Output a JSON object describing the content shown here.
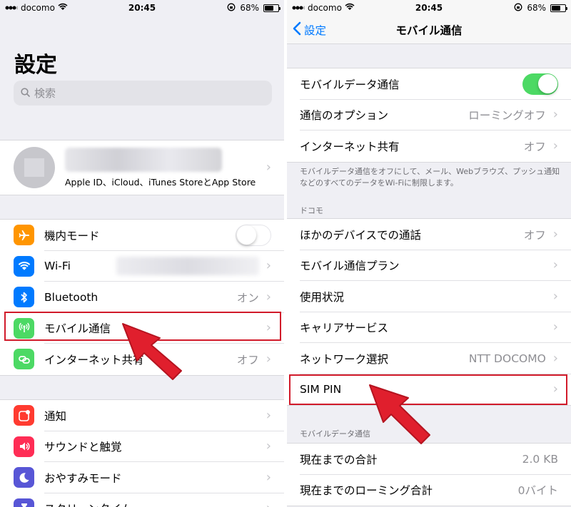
{
  "status_left": {
    "carrier": "docomo",
    "time": "20:45",
    "battery": "68%",
    "battery_level": 0.68
  },
  "status_right": {
    "carrier": "docomo",
    "time": "20:45",
    "battery": "68%",
    "battery_level": 0.68
  },
  "left": {
    "title": "設定",
    "search_placeholder": "検索",
    "profile_sub": "Apple ID、iCloud、iTunes StoreとApp Store",
    "group1": [
      {
        "label": "機内モード",
        "icon": "airplane-icon",
        "color": "#ff9500",
        "toggle": false
      },
      {
        "label": "Wi-Fi",
        "icon": "wifi-icon",
        "color": "#007aff",
        "value": ""
      },
      {
        "label": "Bluetooth",
        "icon": "bluetooth-icon",
        "color": "#007aff",
        "value": "オン"
      },
      {
        "label": "モバイル通信",
        "icon": "antenna-icon",
        "color": "#4cd964",
        "value": ""
      },
      {
        "label": "インターネット共有",
        "icon": "link-icon",
        "color": "#4cd964",
        "value": "オフ"
      }
    ],
    "group2": [
      {
        "label": "通知",
        "icon": "notification-icon",
        "color": "#ff3b30"
      },
      {
        "label": "サウンドと触覚",
        "icon": "sound-icon",
        "color": "#ff2d55"
      },
      {
        "label": "おやすみモード",
        "icon": "moon-icon",
        "color": "#5856d6"
      },
      {
        "label": "スクリーンタイム",
        "icon": "hourglass-icon",
        "color": "#5856d6"
      }
    ]
  },
  "right": {
    "back_label": "設定",
    "title": "モバイル通信",
    "group1": [
      {
        "label": "モバイルデータ通信",
        "toggle": true
      },
      {
        "label": "通信のオプション",
        "value": "ローミングオフ"
      },
      {
        "label": "インターネット共有",
        "value": "オフ"
      }
    ],
    "footnote": "モバイルデータ通信をオフにして、メール、Webブラウズ、プッシュ通知などのすべてのデータをWi-Fiに制限します。",
    "section_docomo": "ドコモ",
    "group2": [
      {
        "label": "ほかのデバイスでの通話",
        "value": "オフ"
      },
      {
        "label": "モバイル通信プラン",
        "value": ""
      },
      {
        "label": "使用状況",
        "value": ""
      },
      {
        "label": "キャリアサービス",
        "value": ""
      },
      {
        "label": "ネットワーク選択",
        "value": "NTT DOCOMO"
      },
      {
        "label": "SIM PIN",
        "value": ""
      }
    ],
    "section_data": "モバイルデータ通信",
    "group3": [
      {
        "label": "現在までの合計",
        "value": "2.0 KB"
      },
      {
        "label": "現在までのローミング合計",
        "value": "0バイト"
      }
    ]
  },
  "colors": {
    "highlight": "#d11a2a",
    "accent": "#007aff",
    "toggle_on": "#4cd964"
  }
}
